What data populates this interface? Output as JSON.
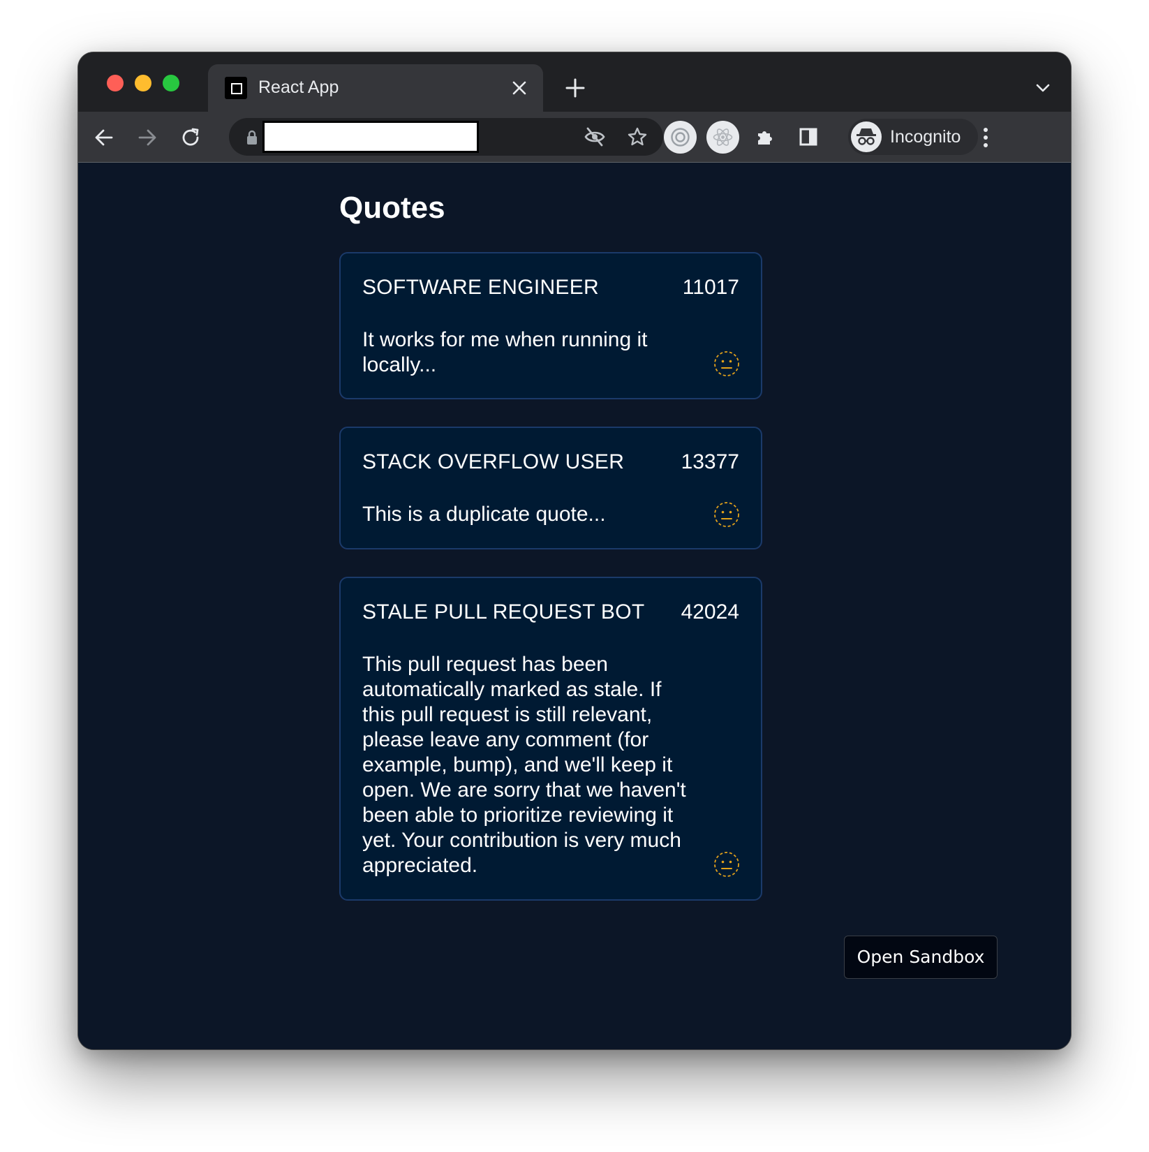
{
  "browser": {
    "tab_title": "React App",
    "profile_label": "Incognito",
    "icons": [
      "back-icon",
      "forward-icon",
      "reload-icon",
      "lock-icon",
      "eye-off-icon",
      "star-icon",
      "extension-icon",
      "puzzle-icon",
      "side-panel-icon",
      "incognito-icon",
      "more-icon"
    ]
  },
  "page": {
    "title": "Quotes",
    "quotes": [
      {
        "author": "SOFTWARE ENGINEER",
        "score": "11017",
        "text": "It works for me when running it locally..."
      },
      {
        "author": "STACK OVERFLOW USER",
        "score": "13377",
        "text": "This is a duplicate quote..."
      },
      {
        "author": "STALE PULL REQUEST BOT",
        "score": "42024",
        "text": "This pull request has been automatically marked as stale. If this pull request is still relevant, please leave any comment (for example, bump), and we'll keep it open. We are sorry that we haven't been able to prioritize reviewing it yet. Your contribution is very much appreciated."
      }
    ],
    "sandbox_button": "Open Sandbox"
  },
  "colors": {
    "page_background": "#0c1627",
    "card_background": "#001a33",
    "card_border": "#1b3a6a",
    "face_icon": "#e3a21a"
  }
}
